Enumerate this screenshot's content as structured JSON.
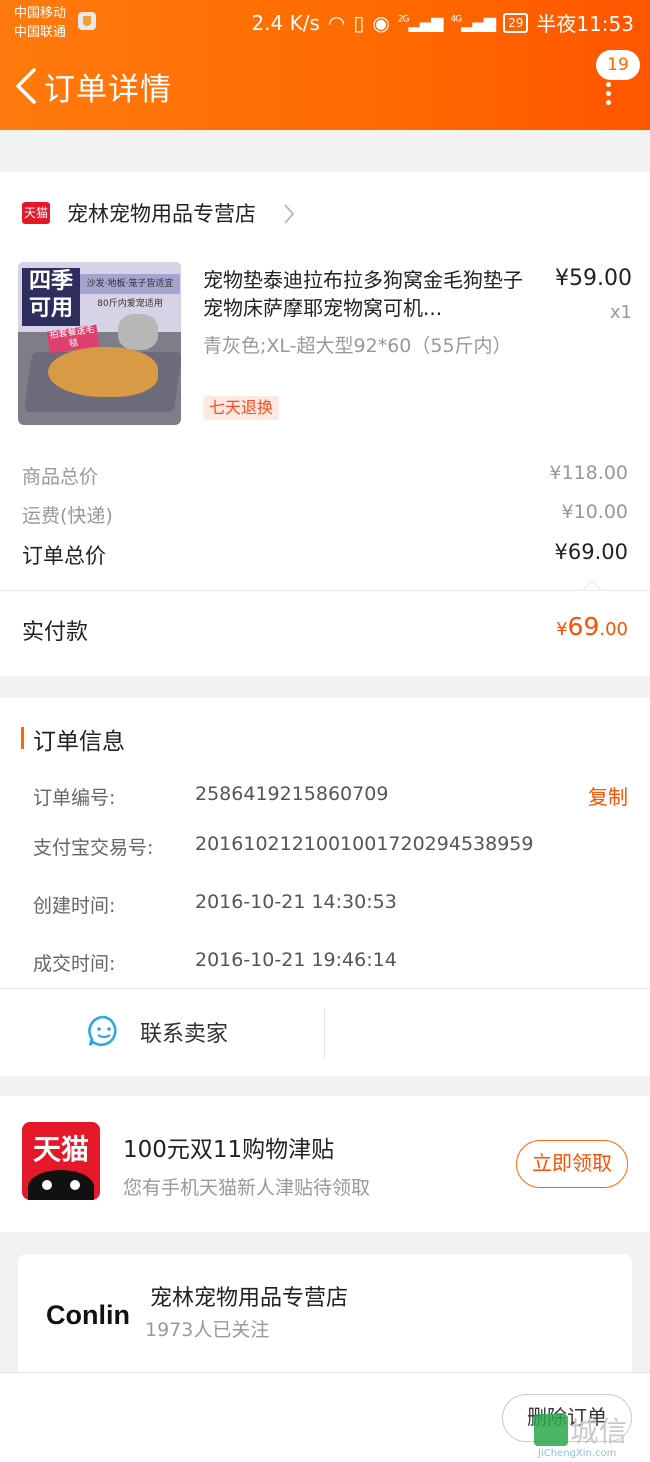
{
  "status_bar": {
    "carrier1": "中国移动",
    "carrier2": "中国联通",
    "speed": "2.4 K/s",
    "net1": "2G",
    "net2": "4G",
    "battery": "29",
    "time": "半夜11:53"
  },
  "header": {
    "title": "订单详情",
    "badge_count": "19",
    "accent_color": "#ff6a00"
  },
  "store": {
    "platform_badge": "天猫",
    "name": "宠林宠物用品专营店"
  },
  "product": {
    "image_text_main": "四季可用",
    "image_text_banner": "沙发·地板·笼子皆适宜",
    "image_text_sub": "80斤内爱宠适用",
    "image_text_ribbon": "拍套餐送毛毯",
    "title": "宠物垫泰迪拉布拉多狗窝金毛狗垫子宠物床萨摩耶宠物窝可机...",
    "price": "¥59.00",
    "quantity": "x1",
    "sku": "青灰色;XL-超大型92*60（55斤内）",
    "tag": "七天退换"
  },
  "summary": {
    "goods_total_label": "商品总价",
    "goods_total_value": "¥118.00",
    "shipping_label": "运费(快递)",
    "shipping_value": "¥10.00",
    "order_total_label": "订单总价",
    "order_total_value": "¥69.00",
    "paid_label": "实付款",
    "paid_currency": "¥",
    "paid_integer": "69",
    "paid_decimal": ".00"
  },
  "order_info": {
    "section_title": "订单信息",
    "order_no_label": "订单编号:",
    "order_no_value": "2586419215860709",
    "copy_label": "复制",
    "alipay_label": "支付宝交易号:",
    "alipay_value": "2016102121001001720294538959",
    "created_label": "创建时间:",
    "created_value": "2016-10-21 14:30:53",
    "deal_label": "成交时间:",
    "deal_value": "2016-10-21 19:46:14"
  },
  "contact": {
    "label": "联系卖家"
  },
  "promo": {
    "logo_text": "天猫",
    "title": "100元双11购物津贴",
    "subtitle": "您有手机天猫新人津贴待领取",
    "button": "立即领取"
  },
  "shop_card": {
    "logo_text": "Conlin",
    "name": "宠林宠物用品专营店",
    "followers": "1973人已关注"
  },
  "bottom": {
    "delete_button": "删除订单"
  },
  "watermark": {
    "text": "城信",
    "sub": "JiChengXin.com"
  }
}
